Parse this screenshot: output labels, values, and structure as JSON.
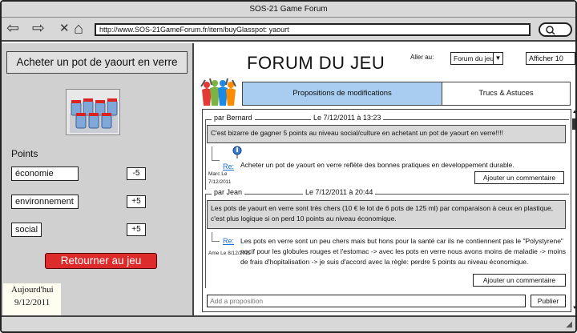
{
  "window": {
    "title": "SOS-21 Game Forum"
  },
  "nav": {
    "back_glyph": "⇦",
    "forward_glyph": "⇨",
    "close_glyph": "✕",
    "home_glyph": "⌂",
    "url": "http://www.SOS-21GameForum.fr/item/buyGlasspot: yaourt",
    "search_glyph": "🔍"
  },
  "product": {
    "title": "Acheter un pot de yaourt en verre",
    "points_heading": "Points",
    "stats": [
      {
        "label": "économie",
        "value": "-5"
      },
      {
        "label": "environnement",
        "value": "+5"
      },
      {
        "label": "social",
        "value": "+5"
      }
    ],
    "return_label": "Retourner au jeu",
    "today_label": "Aujourd'hui",
    "today_date": "9/12/2011"
  },
  "header": {
    "title": "FORUM DU JEU",
    "goto_label": "Aller au:",
    "forum_select": "Forum du jeu",
    "show_select": "Afficher 10"
  },
  "tabs": [
    {
      "label": "Propositions de modifications",
      "active": true
    },
    {
      "label": "Trucs & Astuces",
      "active": false
    }
  ],
  "posts": [
    {
      "author": "par Bernard",
      "date": "Le 7/12/2011 à 13:23",
      "body": "C'est bizarre de gagner 5 points au niveau social/culture en achetant un pot de yaourt en verre!!!!",
      "reply": {
        "re_label": "Re:",
        "author_lines": [
          "Marc Le",
          "7/12/2011"
        ],
        "text": "Acheter un pot de yaourt en verre reflète des bonnes pratiques en developpement durable."
      },
      "add_comment_label": "Ajouter un commentaire"
    },
    {
      "author": "par Jean",
      "date": "Le 7/12/2011 à 20:44",
      "body": "Les pots de yaourt en verre sont très chers (10 € le lot de 6 pots de 125 ml) par comparaison à ceux en plastique, c'est plus logique si on perd 10 points au niveau économique.",
      "reply": {
        "re_label": "Re:",
        "author_lines": [
          "Ame Le 8/12/2011"
        ],
        "text": "Les pots en verre sont un peu chers mais but hons pour la santé car ils ne contiennent pas le \"Polystyrene\" nocif pour les globules rouges et l'estomac -> avec les pots en verre nous avons moins de maladie -> moins de frais d'hopitalisation -> je suis d'accord avec la règle: perdre 5 points au niveau économique."
      },
      "add_comment_label": "Ajouter un commentaire"
    }
  ],
  "proposal": {
    "placeholder": "Add a proposition",
    "publish_label": "Publier"
  },
  "colors": {
    "accent_tab": "#a8cdf0",
    "return_button": "#dd2a2a",
    "panel_gray": "#d0d0d0",
    "link_blue": "#1b6fd0"
  },
  "icons": [
    "back-arrow-icon",
    "forward-arrow-icon",
    "close-icon",
    "home-icon",
    "search-icon",
    "chevron-down-icon",
    "people-logo-icon",
    "pin-icon",
    "resize-grip-icon"
  ]
}
